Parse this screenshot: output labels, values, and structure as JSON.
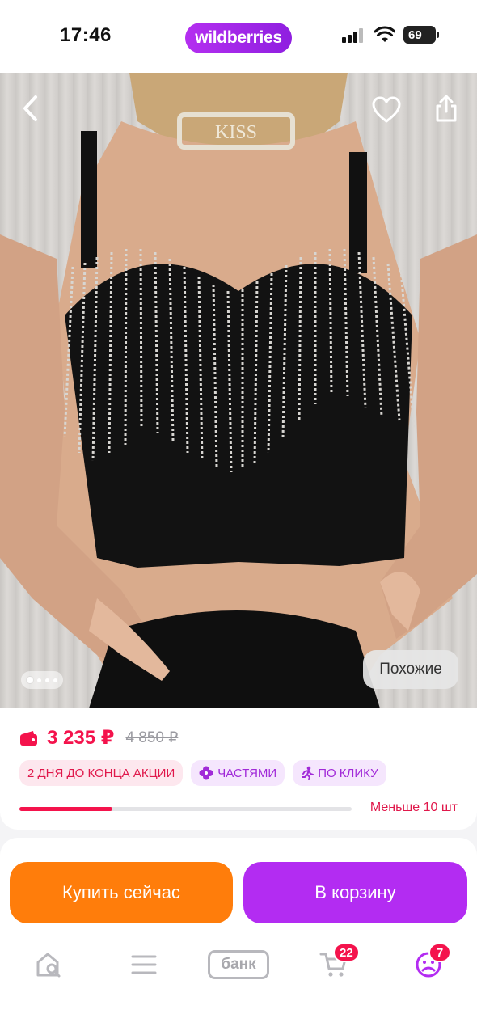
{
  "status_bar": {
    "time": "17:46",
    "brand": "wildberries",
    "battery": "69"
  },
  "photo": {
    "necklace_text": "KISS",
    "similar_label": "Похожие",
    "slides_total": 4,
    "slide_active": 1
  },
  "price": {
    "current": "3 235 ₽",
    "old": "4 850 ₽"
  },
  "badges": {
    "sale": "2 ДНЯ ДО КОНЦА АКЦИИ",
    "parts": "ЧАСТЯМИ",
    "click": "ПО КЛИКУ"
  },
  "stock": {
    "label": "Меньше 10 шт",
    "level": 0.28
  },
  "actions": {
    "buy_now": "Купить сейчас",
    "add_to_cart": "В корзину"
  },
  "tabbar": {
    "bank_label": "банк",
    "cart_count": "22",
    "profile_count": "7"
  },
  "colors": {
    "brand_purple": "#b32cf2",
    "buy_orange": "#ff7d0b",
    "price_red": "#f4134c"
  },
  "icons": [
    "back-icon",
    "heart-icon",
    "share-icon",
    "wallet-icon",
    "clover-icon",
    "running-icon",
    "home-search-icon",
    "menu-icon",
    "cart-icon",
    "profile-icon"
  ]
}
